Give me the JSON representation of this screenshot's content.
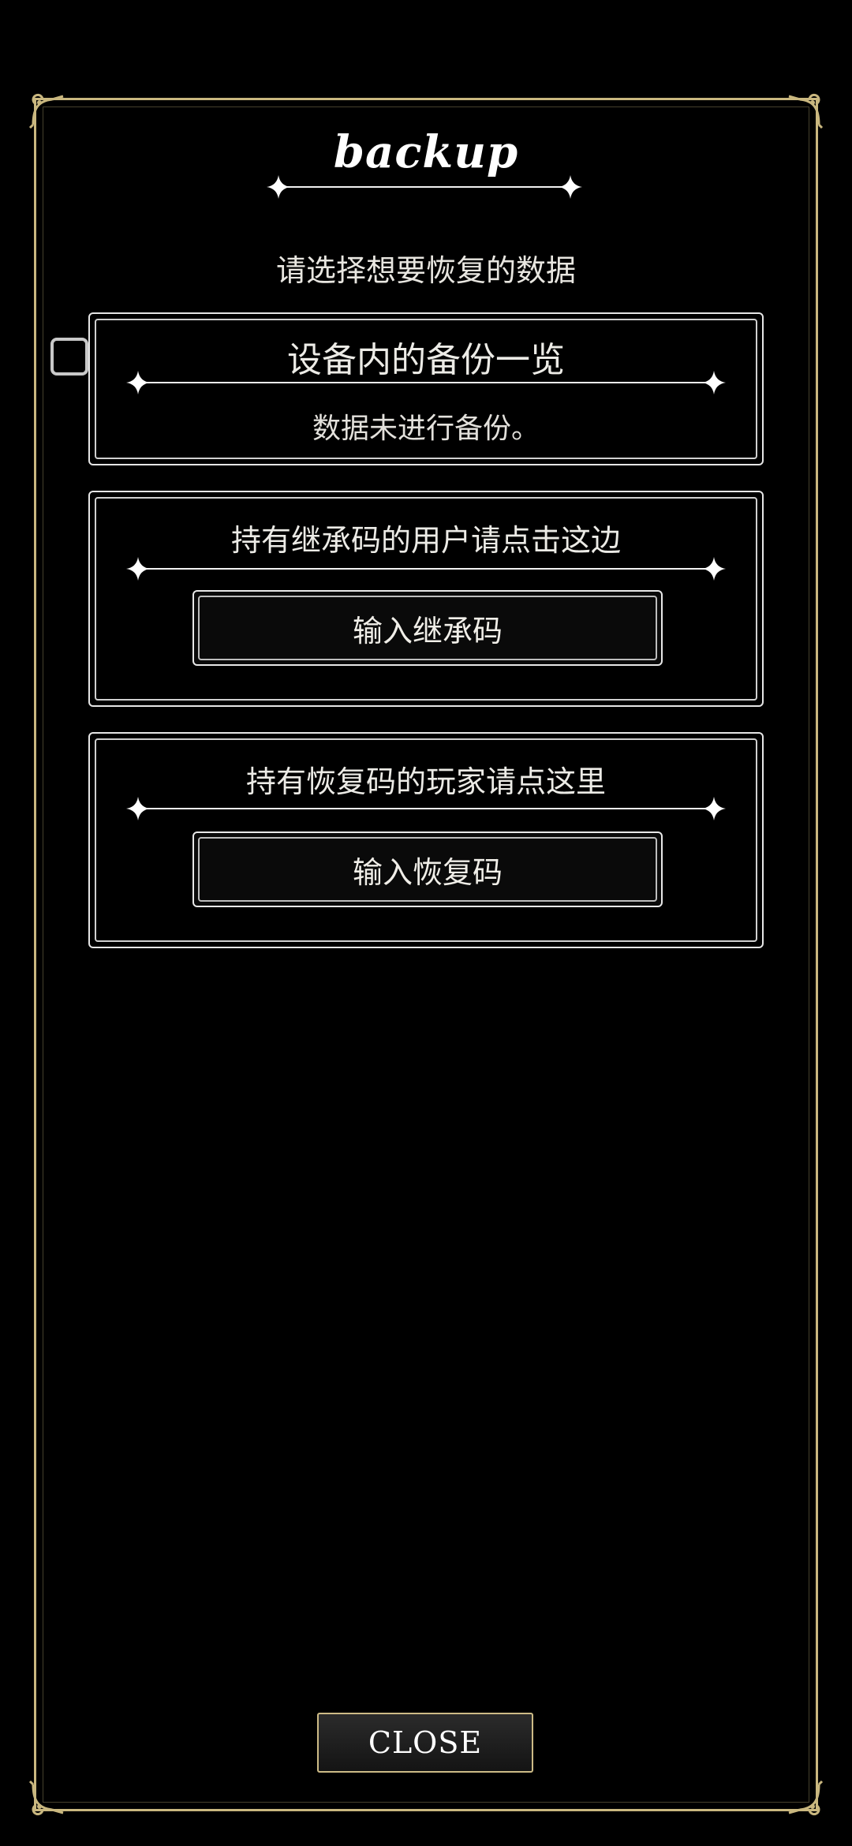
{
  "header": {
    "title": "backup",
    "subtitle": "请选择想要恢复的数据"
  },
  "device_backup": {
    "title": "设备内的备份一览",
    "status": "数据未进行备份。"
  },
  "inherit_code": {
    "prompt": "持有继承码的用户请点击这边",
    "button_label": "输入继承码"
  },
  "recovery_code": {
    "prompt": "持有恢复码的玩家请点这里",
    "button_label": "输入恢复码"
  },
  "footer": {
    "close_label": "CLOSE"
  },
  "colors": {
    "background": "#000000",
    "frame_gold": "#c9b77f",
    "panel_border": "#e6e6e6",
    "text": "#e9e6df"
  }
}
